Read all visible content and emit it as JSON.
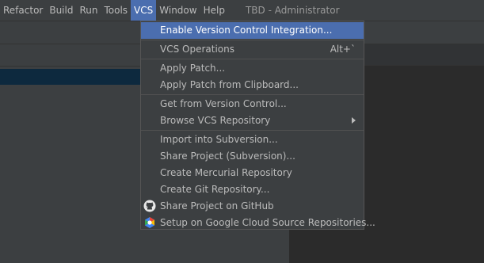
{
  "menubar": {
    "items": [
      {
        "label": "Refactor"
      },
      {
        "label": "Build"
      },
      {
        "label": "Run"
      },
      {
        "label": "Tools"
      },
      {
        "label": "VCS"
      },
      {
        "label": "Window"
      },
      {
        "label": "Help"
      }
    ],
    "window_title": "TBD - Administrator"
  },
  "vcs_menu": {
    "items": [
      {
        "label": "Enable Version Control Integration..."
      },
      {
        "label": "VCS Operations",
        "shortcut": "Alt+`"
      },
      {
        "label": "Apply Patch..."
      },
      {
        "label": "Apply Patch from Clipboard..."
      },
      {
        "label": "Get from Version Control..."
      },
      {
        "label": "Browse VCS Repository"
      },
      {
        "label": "Import into Subversion..."
      },
      {
        "label": "Share Project (Subversion)..."
      },
      {
        "label": "Create Mercurial Repository"
      },
      {
        "label": "Create Git Repository..."
      },
      {
        "label": "Share Project on GitHub",
        "icon": "github-icon"
      },
      {
        "label": "Setup on Google Cloud Source Repositories...",
        "icon": "google-cloud-icon"
      }
    ]
  },
  "colors": {
    "accent": "#4b6eaf",
    "menu_bg": "#3c3f41",
    "editor_bg": "#2b2b2b"
  }
}
